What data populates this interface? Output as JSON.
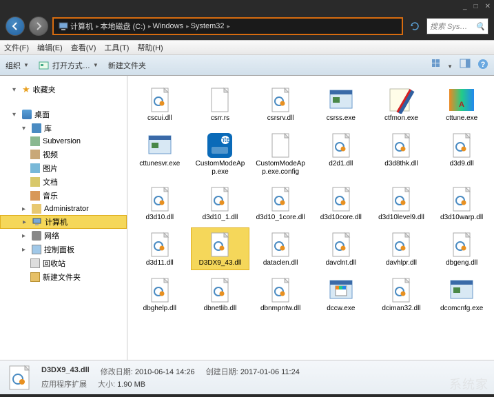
{
  "window": {
    "min": "_",
    "max": "□",
    "close": "✕"
  },
  "nav": {
    "back": "←",
    "fwd": "→"
  },
  "breadcrumb": {
    "sep": "▸",
    "items": [
      "计算机",
      "本地磁盘 (C:)",
      "Windows",
      "System32"
    ]
  },
  "search": {
    "placeholder": "搜索 Sys…",
    "icon": "🔍"
  },
  "menu": {
    "file": "文件(F)",
    "edit": "编辑(E)",
    "view": "查看(V)",
    "tools": "工具(T)",
    "help": "帮助(H)"
  },
  "toolbar": {
    "organize": "组织",
    "open_with": "打开方式…",
    "new_folder": "新建文件夹"
  },
  "sidebar": {
    "favorites": "收藏夹",
    "desktop": "桌面",
    "library": "库",
    "lib_items": [
      "Subversion",
      "视频",
      "图片",
      "文档",
      "音乐"
    ],
    "admin": "Administrator",
    "computer": "计算机",
    "network": "网络",
    "control_panel": "控制面板",
    "recycle": "回收站",
    "new_folder": "新建文件夹"
  },
  "files": {
    "items": [
      {
        "name": "cscui.dll",
        "type": "dll"
      },
      {
        "name": "csrr.rs",
        "type": "file"
      },
      {
        "name": "csrsrv.dll",
        "type": "dll"
      },
      {
        "name": "csrss.exe",
        "type": "exe"
      },
      {
        "name": "ctfmon.exe",
        "type": "pen"
      },
      {
        "name": "cttune.exe",
        "type": "ct"
      },
      {
        "name": "cttunesvr.exe",
        "type": "exe"
      },
      {
        "name": "CustomModeApp.exe",
        "type": "intel"
      },
      {
        "name": "CustomModeApp.exe.config",
        "type": "file"
      },
      {
        "name": "d2d1.dll",
        "type": "dll"
      },
      {
        "name": "d3d8thk.dll",
        "type": "dll"
      },
      {
        "name": "d3d9.dll",
        "type": "dll"
      },
      {
        "name": "d3d10.dll",
        "type": "dll"
      },
      {
        "name": "d3d10_1.dll",
        "type": "dll"
      },
      {
        "name": "d3d10_1core.dll",
        "type": "dll"
      },
      {
        "name": "d3d10core.dll",
        "type": "dll"
      },
      {
        "name": "d3d10level9.dll",
        "type": "dll"
      },
      {
        "name": "d3d10warp.dll",
        "type": "dll"
      },
      {
        "name": "d3d11.dll",
        "type": "dll"
      },
      {
        "name": "D3DX9_43.dll",
        "type": "dll",
        "selected": true
      },
      {
        "name": "dataclen.dll",
        "type": "dll"
      },
      {
        "name": "davclnt.dll",
        "type": "dll"
      },
      {
        "name": "davhlpr.dll",
        "type": "dll"
      },
      {
        "name": "dbgeng.dll",
        "type": "dll"
      },
      {
        "name": "dbghelp.dll",
        "type": "dll"
      },
      {
        "name": "dbnetlib.dll",
        "type": "dll"
      },
      {
        "name": "dbnmpntw.dll",
        "type": "dll"
      },
      {
        "name": "dccw.exe",
        "type": "dccw"
      },
      {
        "name": "dciman32.dll",
        "type": "dll"
      },
      {
        "name": "dcomcnfg.exe",
        "type": "exe"
      }
    ]
  },
  "status": {
    "filename": "D3DX9_43.dll",
    "mod_label": "修改日期:",
    "mod_value": "2010-06-14 14:26",
    "create_label": "创建日期:",
    "create_value": "2017-01-06 11:24",
    "type": "应用程序扩展",
    "size_label": "大小:",
    "size_value": "1.90 MB"
  },
  "watermark": "系统家"
}
